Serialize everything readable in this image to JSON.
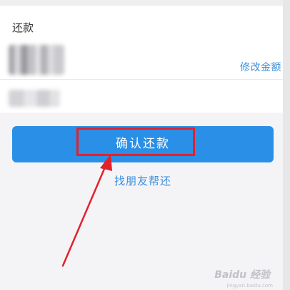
{
  "card": {
    "title": "还款",
    "modify_label": "修改金额"
  },
  "actions": {
    "confirm_label": "确认还款",
    "friend_label": "找朋友帮还"
  },
  "annotation": {
    "color": "#e3212a"
  },
  "watermark": {
    "text": "Baidu 经验",
    "sub": "jingyan.baidu.com"
  },
  "colors": {
    "accent": "#2a8fe6",
    "link": "#3d8fdd",
    "background": "#f4f4f7"
  }
}
